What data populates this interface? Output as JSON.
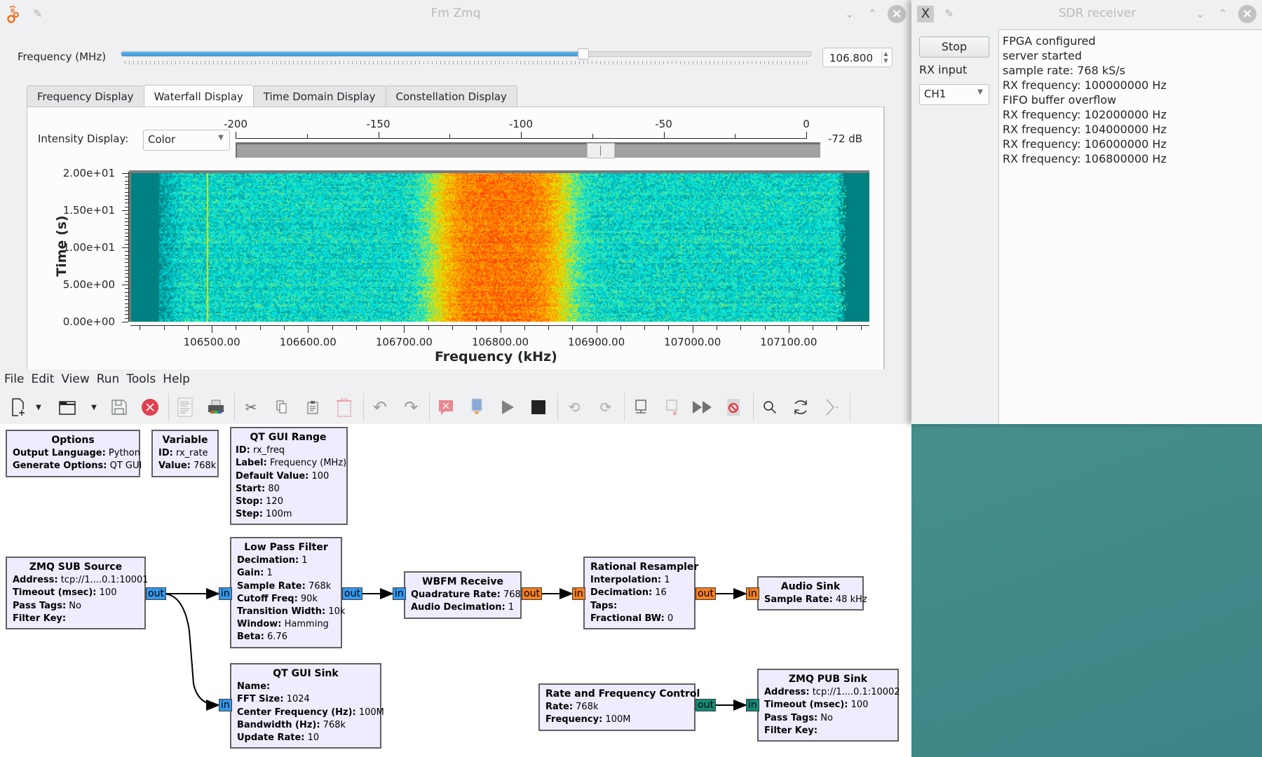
{
  "desktop": {
    "background_color": "#3e8384"
  },
  "fm_window": {
    "title": "Fm Zmq",
    "frequency_control": {
      "label": "Frequency (MHz)",
      "value": "106.800",
      "min": 80,
      "max": 120,
      "slider_fraction": 0.67
    },
    "tabs": [
      {
        "label": "Frequency Display",
        "active": false
      },
      {
        "label": "Waterfall Display",
        "active": true
      },
      {
        "label": "Time Domain Display",
        "active": false
      },
      {
        "label": "Constellation Display",
        "active": false
      }
    ],
    "intensity": {
      "label": "Intensity Display:",
      "selected": "Color",
      "scale_labels": [
        "-200",
        "-150",
        "-100",
        "-50",
        "0"
      ],
      "scale_min": -200,
      "scale_max": 0,
      "handle_value_db": -72,
      "value_label": "-72 dB"
    }
  },
  "chart_data": {
    "type": "heatmap",
    "title": "Waterfall Display",
    "xlabel": "Frequency (kHz)",
    "ylabel": "Time (s)",
    "x_ticks": [
      "106500.00",
      "106600.00",
      "106700.00",
      "106800.00",
      "106900.00",
      "107000.00",
      "107100.00"
    ],
    "y_ticks": [
      "2.00e+01",
      "1.50e+01",
      "1.00e+01",
      "5.00e+00",
      "0.00e+00"
    ],
    "xlim": [
      106416,
      107184
    ],
    "ylim": [
      0,
      20
    ],
    "signal_center_khz": 106800,
    "signal_bandwidth_khz": 150,
    "spur_khz": 106495,
    "colormap": [
      "#008080",
      "#00e5e5",
      "#e5e500",
      "#ff8c00",
      "#ff2000"
    ]
  },
  "grc": {
    "menu": [
      "File",
      "Edit",
      "View",
      "Run",
      "Tools",
      "Help"
    ],
    "toolbar": [
      {
        "name": "new-icon"
      },
      {
        "name": "new-dropdown-icon"
      },
      {
        "name": "open-icon"
      },
      {
        "name": "open-dropdown-icon"
      },
      {
        "name": "save-icon"
      },
      {
        "name": "close-icon"
      },
      {
        "name": "report-icon"
      },
      {
        "name": "print-icon"
      },
      {
        "name": "cut-icon"
      },
      {
        "name": "copy-icon"
      },
      {
        "name": "paste-icon"
      },
      {
        "name": "delete-icon"
      },
      {
        "name": "undo-icon"
      },
      {
        "name": "redo-icon"
      },
      {
        "name": "errors-icon"
      },
      {
        "name": "generate-icon"
      },
      {
        "name": "execute-icon"
      },
      {
        "name": "kill-icon"
      },
      {
        "name": "rotate-ccw-icon"
      },
      {
        "name": "rotate-cw-icon"
      },
      {
        "name": "enable-icon"
      },
      {
        "name": "disable-icon"
      },
      {
        "name": "bypass-icon"
      },
      {
        "name": "stop-icon"
      },
      {
        "name": "find-icon"
      },
      {
        "name": "reload-icon"
      },
      {
        "name": "console-icon"
      }
    ],
    "blocks": {
      "options": {
        "title": "Options",
        "params": [
          [
            "Output Language:",
            "Python"
          ],
          [
            "Generate Options:",
            "QT GUI"
          ]
        ]
      },
      "variable": {
        "title": "Variable",
        "params": [
          [
            "ID:",
            "rx_rate"
          ],
          [
            "Value:",
            "768k"
          ]
        ]
      },
      "qt_gui_range": {
        "title": "QT GUI Range",
        "params": [
          [
            "ID:",
            "rx_freq"
          ],
          [
            "Label:",
            "Frequency (MHz)"
          ],
          [
            "Default Value:",
            "100"
          ],
          [
            "Start:",
            "80"
          ],
          [
            "Stop:",
            "120"
          ],
          [
            "Step:",
            "100m"
          ]
        ]
      },
      "zmq_sub_source": {
        "title": "ZMQ SUB Source",
        "params": [
          [
            "Address:",
            "tcp://1....0.1:10001"
          ],
          [
            "Timeout (msec):",
            "100"
          ],
          [
            "Pass Tags:",
            "No"
          ],
          [
            "Filter Key:",
            ""
          ]
        ],
        "ports": {
          "out": "out"
        }
      },
      "low_pass_filter": {
        "title": "Low Pass Filter",
        "params": [
          [
            "Decimation:",
            "1"
          ],
          [
            "Gain:",
            "1"
          ],
          [
            "Sample Rate:",
            "768k"
          ],
          [
            "Cutoff Freq:",
            "90k"
          ],
          [
            "Transition Width:",
            "10k"
          ],
          [
            "Window:",
            "Hamming"
          ],
          [
            "Beta:",
            "6.76"
          ]
        ],
        "ports": {
          "in": "in",
          "out": "out"
        }
      },
      "wbfm_receive": {
        "title": "WBFM Receive",
        "params": [
          [
            "Quadrature Rate:",
            "768k"
          ],
          [
            "Audio Decimation:",
            "1"
          ]
        ],
        "ports": {
          "in": "in",
          "out": "out"
        }
      },
      "rational_resampler": {
        "title": "Rational Resampler",
        "params": [
          [
            "Interpolation:",
            "1"
          ],
          [
            "Decimation:",
            "16"
          ],
          [
            "Taps:",
            ""
          ],
          [
            "Fractional BW:",
            "0"
          ]
        ],
        "ports": {
          "in": "in",
          "out": "out"
        }
      },
      "audio_sink": {
        "title": "Audio Sink",
        "params": [
          [
            "Sample Rate:",
            "48 kHz"
          ]
        ],
        "ports": {
          "in": "in"
        }
      },
      "qt_gui_sink": {
        "title": "QT GUI Sink",
        "params": [
          [
            "Name:",
            ""
          ],
          [
            "FFT Size:",
            "1024"
          ],
          [
            "Center Frequency (Hz):",
            "100M"
          ],
          [
            "Bandwidth (Hz):",
            "768k"
          ],
          [
            "Update Rate:",
            "10"
          ]
        ],
        "ports": {
          "in": "in"
        }
      },
      "rate_freq_control": {
        "title": "Rate and Frequency Control",
        "params": [
          [
            "Rate:",
            "768k"
          ],
          [
            "Frequency:",
            "100M"
          ]
        ],
        "ports": {
          "out": "out"
        }
      },
      "zmq_pub_sink": {
        "title": "ZMQ PUB Sink",
        "params": [
          [
            "Address:",
            "tcp://1....0.1:10002"
          ],
          [
            "Timeout (msec):",
            "100"
          ],
          [
            "Pass Tags:",
            "No"
          ],
          [
            "Filter Key:",
            ""
          ]
        ],
        "ports": {
          "in": "in"
        }
      }
    },
    "port_colors": {
      "complex": "#3399ee",
      "float": "#f58020",
      "message": "#128c7a"
    }
  },
  "sdr_window": {
    "title": "SDR receiver",
    "stop_label": "Stop",
    "rx_input_label": "RX input",
    "rx_input_selected": "CH1",
    "log": [
      "FPGA configured",
      "server started",
      "sample rate: 768 kS/s",
      "RX frequency: 100000000 Hz",
      "FIFO buffer overflow",
      "RX frequency: 102000000 Hz",
      "RX frequency: 104000000 Hz",
      "RX frequency: 106000000 Hz",
      "RX frequency: 106800000 Hz"
    ]
  }
}
